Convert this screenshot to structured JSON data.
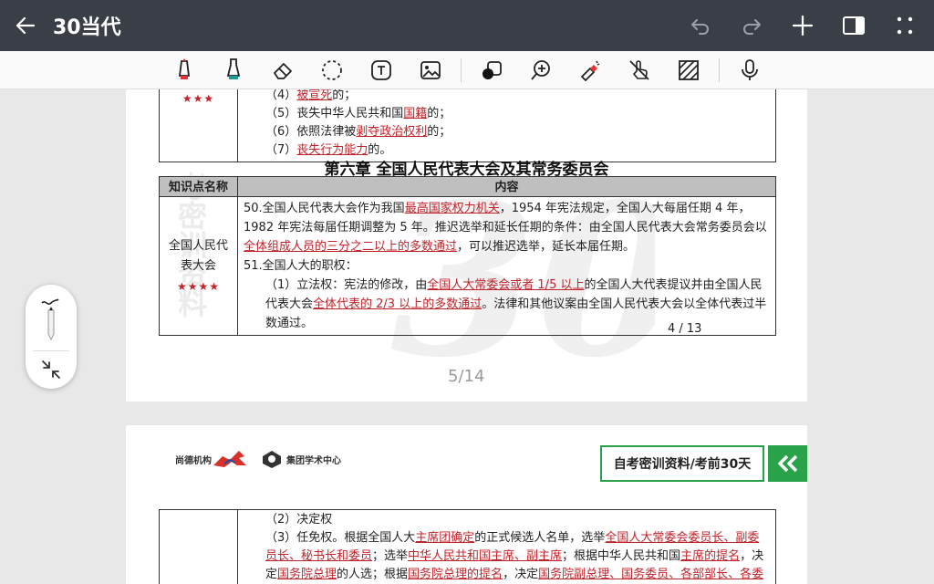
{
  "app": {
    "title": "30当代"
  },
  "toolbar": {
    "tools": [
      "pen-red-icon",
      "highlighter-icon",
      "eraser-icon",
      "lasso-select-icon",
      "text-box-icon",
      "image-insert-icon",
      "shape-icon",
      "zoom-in-icon",
      "laser-pointer-icon",
      "finger-draw-icon",
      "pattern-icon",
      "microphone-icon"
    ]
  },
  "page1": {
    "top_row": {
      "stars": "★★★",
      "lines": [
        {
          "prefix": "（4）",
          "red": "被宣死",
          "suffix": "的；"
        },
        {
          "prefix": "（5）丧失中华人民共和国",
          "red": "国籍",
          "suffix": "的；"
        },
        {
          "prefix": "（6）依照法律被",
          "red": "剥夺政治权利",
          "suffix": "的；"
        },
        {
          "prefix": "（7）",
          "red": "丧失行为能力",
          "suffix": "的。"
        }
      ]
    },
    "chapter_title": "第六章  全国人民代表大会及其常务委员会",
    "table_header": {
      "col1": "知识点名称",
      "col2": "内容"
    },
    "row": {
      "name_line1": "全国人民代",
      "name_line2": "表大会",
      "stars": "★★★★",
      "p50_a": "50.全国人民代表大会作为我国",
      "p50_red1": "最高国家权力机关",
      "p50_b": "，1954 年宪法规定，全国人大每届任期 4 年，1982 年宪法每届任期调整为 5 年。推迟选举和延长任期的条件：由全国人民代表大会常务委员会以",
      "p50_red2": "全体组成人员的三分之二以上的多数通过",
      "p50_c": "，可以推迟选举，延长本届任期。",
      "p51": "51.全国人大的职权：",
      "p51_1a": "（1）立法权：宪法的修改，由",
      "p51_1red1": "全国人大常委会或者 1/5 以上",
      "p51_1b": "的全国人大代表提议并由全国人民代表大会",
      "p51_1red2": "全体代表的 2/3 以上的多数通过",
      "p51_1c": "。法律和其他议案由全国人民代表大会以全体代表过半数通过。"
    },
    "inner_page_number": "4 / 13",
    "page_label": "5/14",
    "watermark_text": "考密训资料"
  },
  "page2": {
    "logo1": "尚德机构",
    "logo2": "集团学术中心",
    "brand": "自考密训资料/考前30天",
    "l2": "（2）决定权",
    "l3a": "（3）任免权。根据全国人大",
    "l3red1": "主席团确定",
    "l3b": "的正式候选人名单，选举",
    "l3red2": "全国人大常委会委员长、副委员长、秘书长和委员",
    "l3c": "；选举",
    "l3red3": "中华人民共和国主席、副主席",
    "l3d": "；根据中华人民共和国",
    "l3red4": "主席的提名",
    "l3e": "，决定",
    "l3red5": "国务院总理",
    "l3f": "的人选；根据",
    "l3red6": "国务院总理的提名",
    "l3g": "，决定",
    "l3red7": "国务院副总理、国务委员、各部部长、各委员会主任、"
  },
  "colors": {
    "appbar": "#3a3f47",
    "accent_red": "#c0242b",
    "brand_green": "#2aa24a"
  }
}
